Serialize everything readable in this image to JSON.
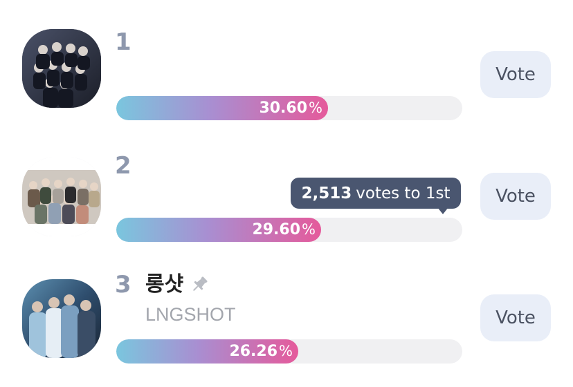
{
  "vote_button_label": "Vote",
  "colors": {
    "rank": "#8e98ad",
    "bar_gradient_start": "#7ac6de",
    "bar_gradient_end": "#e55a9b",
    "vote_button_bg": "#e9eef8",
    "tooltip_bg": "#4a5670"
  },
  "entries": [
    {
      "rank": "1",
      "avatar_icon": "group-photo",
      "percent_value": "30.60",
      "percent_unit": "%",
      "percent_fraction": 0.612
    },
    {
      "rank": "2",
      "avatar_icon": "group-photo",
      "percent_value": "29.60",
      "percent_unit": "%",
      "percent_fraction": 0.592,
      "gap_tooltip": {
        "count": "2,513",
        "label": "votes to 1st"
      }
    },
    {
      "rank": "3",
      "name": "롱샷",
      "subname": "LNGSHOT",
      "pin_icon": "pin-icon",
      "avatar_icon": "group-photo",
      "percent_value": "26.26",
      "percent_unit": "%",
      "percent_fraction": 0.5252
    }
  ]
}
